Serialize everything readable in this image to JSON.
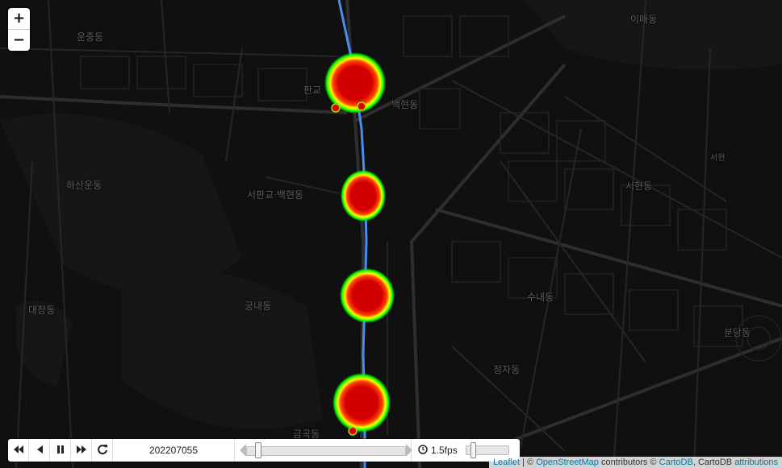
{
  "map": {
    "place_labels": [
      {
        "name": "label-iimae-dong",
        "text": "이매동"
      },
      {
        "name": "label-unjung-dong",
        "text": "운중동"
      },
      {
        "name": "label-pangyo",
        "text": "판교"
      },
      {
        "name": "label-baekhyeon-dong",
        "text": "백현동"
      },
      {
        "name": "label-seohyeon",
        "text": "서현"
      },
      {
        "name": "label-hasanun-dong",
        "text": "하산운동"
      },
      {
        "name": "label-seopangyo-baekhyeon",
        "text": "서판교·백현동"
      },
      {
        "name": "label-seohyeon-dong",
        "text": "서현동"
      },
      {
        "name": "label-daejang-dong",
        "text": "대장동"
      },
      {
        "name": "label-gungnae-dong",
        "text": "궁내동"
      },
      {
        "name": "label-sunae-dong",
        "text": "수내동"
      },
      {
        "name": "label-bundang-dong",
        "text": "분당동"
      },
      {
        "name": "label-jeongja-dong",
        "text": "정자동"
      },
      {
        "name": "label-geumgok-dong",
        "text": "금곡동"
      }
    ],
    "route_color": "#4a8df0",
    "heat_colors": [
      "#00ff00",
      "#ffff00",
      "#ff0000",
      "#cc0000"
    ]
  },
  "zoom": {
    "in": "+",
    "out": "−"
  },
  "timebar": {
    "first_icon": "skip-back-icon",
    "prev_icon": "step-back-icon",
    "pause_icon": "pause-icon",
    "next_icon": "skip-forward-icon",
    "loop_icon": "refresh-icon",
    "date": "202207055",
    "time_position": 0.06,
    "speed_icon": "clock-icon",
    "fps": "1.5fps",
    "speed_position": 0.12
  },
  "attribution": {
    "leaflet": "Leaflet",
    "sep": " | © ",
    "osm": "OpenStreetMap",
    "contrib": " contributors © ",
    "carto": "CartoDB",
    "carto2": ", CartoDB ",
    "attr": "attributions"
  }
}
